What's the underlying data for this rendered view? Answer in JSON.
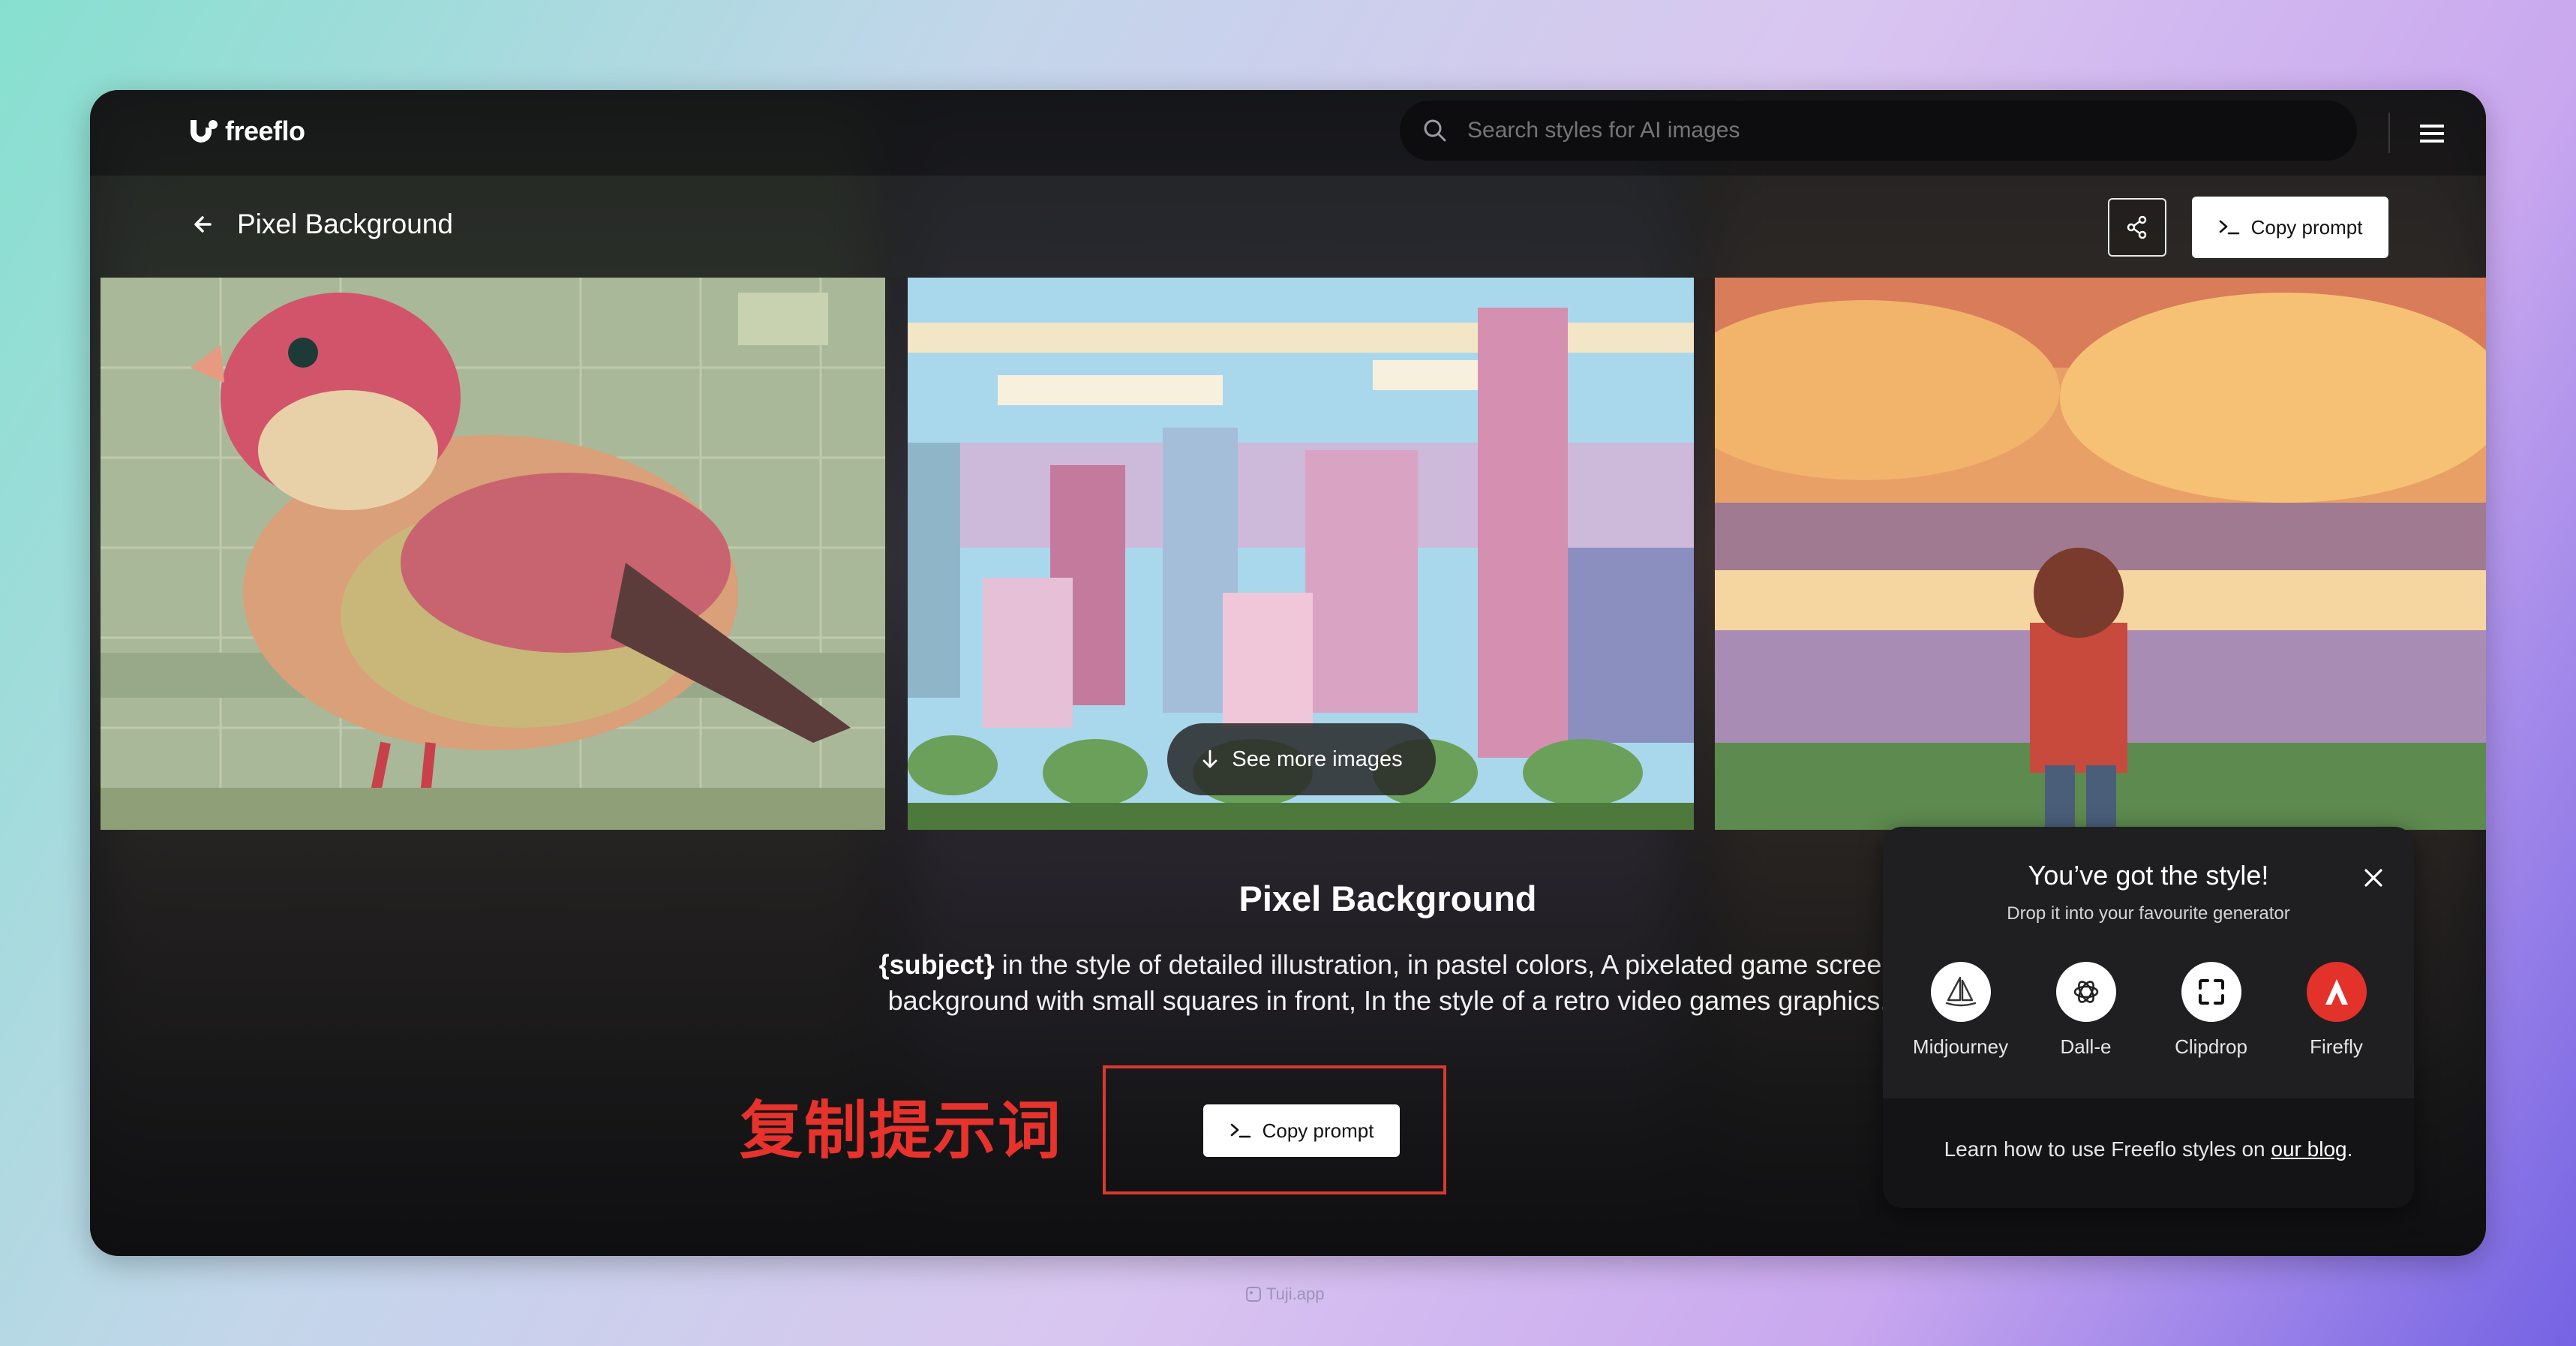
{
  "header": {
    "logo_text": "freeflo",
    "search_placeholder": "Search styles for AI images"
  },
  "title_bar": {
    "back_icon": "arrow-left-icon",
    "title": "Pixel Background",
    "copy_prompt_label": "Copy prompt"
  },
  "gallery": {
    "images": [
      "pixel-art-bird",
      "pixel-art-city-skyline",
      "pixel-art-boy-sunset"
    ],
    "see_more_label": "See more images"
  },
  "style": {
    "name": "Pixel Background",
    "prompt_subject": "{subject}",
    "prompt_rest": " in the style of detailed illustration, in pastel colors, A pixelated game screen background with small squares in front, In the style of a retro video games graphics.",
    "copy_prompt_label": "Copy prompt"
  },
  "annotation": {
    "text": "复制提示词",
    "color": "#e8322c"
  },
  "popup": {
    "title": "You’ve got the style!",
    "subtitle": "Drop it into your favourite generator",
    "generators": [
      {
        "label": "Midjourney",
        "icon": "sailboat-icon"
      },
      {
        "label": "Dall-e",
        "icon": "openai-icon"
      },
      {
        "label": "Clipdrop",
        "icon": "clipdrop-icon"
      },
      {
        "label": "Firefly",
        "icon": "adobe-icon"
      }
    ],
    "footer_prefix": "Learn how to use Freeflo styles on ",
    "footer_link": "our blog",
    "footer_suffix": "."
  },
  "watermark": "Tuji.app",
  "colors": {
    "accent_red": "#e2322a",
    "button_bg": "#ffffff"
  }
}
